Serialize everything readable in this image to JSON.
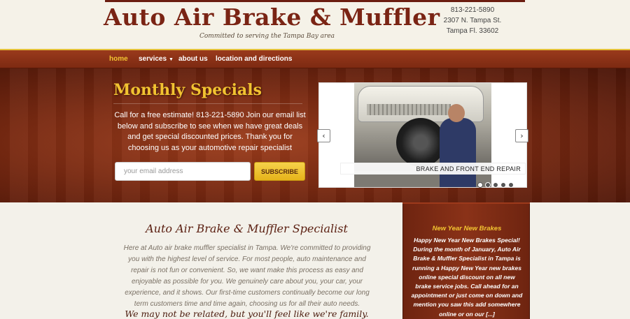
{
  "header": {
    "title": "Auto Air Brake & Muffler",
    "tagline": "Committed to serving the Tampa Bay area",
    "phone": "813-221-5890",
    "address_line1": "2307 N. Tampa St.",
    "address_line2": "Tampa Fl. 33602"
  },
  "nav": {
    "items": [
      {
        "label": "home",
        "active": true
      },
      {
        "label": "services"
      },
      {
        "label": "about us"
      },
      {
        "label": "location and directions"
      }
    ]
  },
  "hero": {
    "title": "Monthly Specials",
    "text": "Call for a free estimate! 813-221-5890 Join our email list below and subscribe to see when we have great deals and get special discounted prices. Thank you for choosing us as your automotive repair specialist",
    "email_placeholder": "your email address",
    "subscribe_label": "SUBSCRIBE"
  },
  "slider": {
    "caption": "BRAKE AND FRONT END REPAIR",
    "prev_icon": "‹",
    "next_icon": "›",
    "dot_count": 5,
    "active_dot": 1
  },
  "main": {
    "title": "Auto Air Brake & Muffler Specialist",
    "text": "Here at Auto air brake muffler specialist in Tampa. We're committed to providing you with the highest level of service. For most people, auto maintenance and repair is not fun or convenient. So, we want make this process as easy and enjoyable as possible for you. We genuinely care about you, your car, your experience, and it shows. Our first-time customers continually become our long term customers time and time again, choosing us for all their auto needs.",
    "quote": "We may not be related, but you'll feel like we're family."
  },
  "sidebar": {
    "title": "New Year New Brakes",
    "text": "Happy New Year New Brakes Special! During the month of January, Auto Air Brake & Muffler Specialist in Tampa is running a Happy New Year new brakes online special discount on all new brake service jobs. Call ahead for an appointment or just come on down and mention you saw this add somewhere online or on our [...]"
  },
  "colors": {
    "brand": "#7a2414",
    "accent": "#f2c331",
    "nav_bg": "#8a3218"
  }
}
